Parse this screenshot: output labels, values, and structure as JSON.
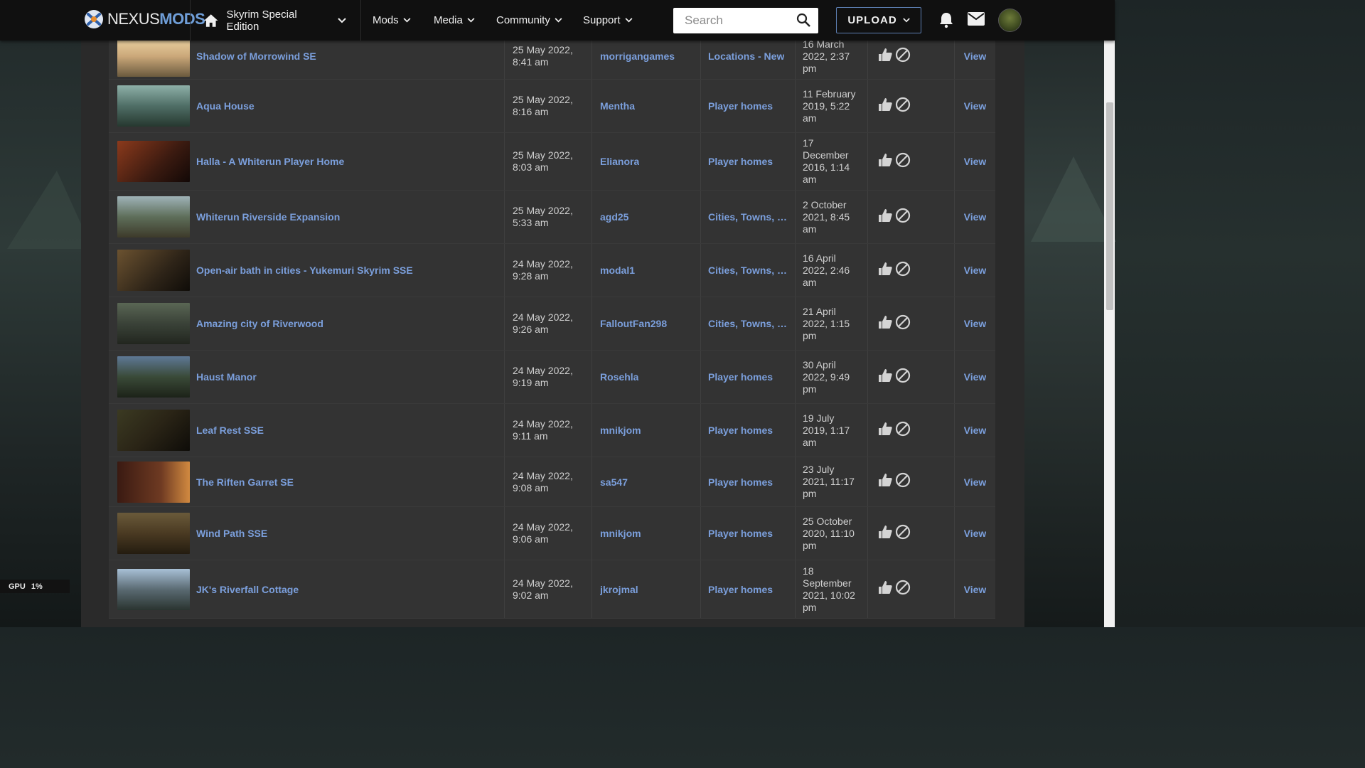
{
  "header": {
    "logo_a": "NEXUS",
    "logo_b": "MODS",
    "game": "Skyrim Special Edition",
    "nav": [
      {
        "label": "Mods"
      },
      {
        "label": "Media"
      },
      {
        "label": "Community"
      },
      {
        "label": "Support"
      }
    ],
    "search_placeholder": "Search",
    "upload_label": "UPLOAD",
    "icons": {
      "home": "home-icon",
      "chevron": "chevron-down-icon",
      "search": "search-icon",
      "bell": "bell-icon",
      "mail": "mail-icon"
    }
  },
  "colors": {
    "link": "#7b9fdc",
    "brand_accent": "#6f9ed8",
    "header_bg": "#101010",
    "row_bg": "#333333"
  },
  "rows": [
    {
      "name": "Shadow of Morrowind SE",
      "date": [
        "25 May 2022,",
        "8:41 am"
      ],
      "author": "morrigangames",
      "category": "Locations - New",
      "updated": [
        "16 March",
        "2022, 2:37",
        "pm"
      ],
      "view": "View"
    },
    {
      "name": "Aqua House",
      "date": [
        "25 May 2022,",
        "8:16 am"
      ],
      "author": "Mentha",
      "category": "Player homes",
      "updated": [
        "11 February",
        "2019, 5:22",
        "am"
      ],
      "view": "View"
    },
    {
      "name": "Halla - A Whiterun Player Home",
      "date": [
        "25 May 2022,",
        "8:03 am"
      ],
      "author": "Elianora",
      "category": "Player homes",
      "updated": [
        "17",
        "December",
        "2016, 1:14",
        "am"
      ],
      "view": "View"
    },
    {
      "name": "Whiterun Riverside Expansion",
      "date": [
        "25 May 2022,",
        "5:33 am"
      ],
      "author": "agd25",
      "category": "Cities, Towns, Vi...",
      "updated": [
        "2 October",
        "2021, 8:45",
        "am"
      ],
      "view": "View"
    },
    {
      "name": "Open-air bath in cities - Yukemuri Skyrim SSE",
      "date": [
        "24 May 2022,",
        "9:28 am"
      ],
      "author": "modal1",
      "category": "Cities, Towns, Vi...",
      "updated": [
        "16 April",
        "2022, 2:46",
        "am"
      ],
      "view": "View"
    },
    {
      "name": "Amazing city of Riverwood",
      "date": [
        "24 May 2022,",
        "9:26 am"
      ],
      "author": "FalloutFan298",
      "category": "Cities, Towns, Vi...",
      "updated": [
        "21 April",
        "2022, 1:15",
        "pm"
      ],
      "view": "View"
    },
    {
      "name": "Haust Manor",
      "date": [
        "24 May 2022,",
        "9:19 am"
      ],
      "author": "Rosehla",
      "category": "Player homes",
      "updated": [
        "30 April",
        "2022, 9:49",
        "pm"
      ],
      "view": "View"
    },
    {
      "name": "Leaf Rest SSE",
      "date": [
        "24 May 2022,",
        "9:11 am"
      ],
      "author": "mnikjom",
      "category": "Player homes",
      "updated": [
        "19 July",
        "2019, 1:17",
        "am"
      ],
      "view": "View"
    },
    {
      "name": "The Riften Garret SE",
      "date": [
        "24 May 2022,",
        "9:08 am"
      ],
      "author": "sa547",
      "category": "Player homes",
      "updated": [
        "23 July",
        "2021, 11:17",
        "pm"
      ],
      "view": "View"
    },
    {
      "name": "Wind Path SSE",
      "date": [
        "24 May 2022,",
        "9:06 am"
      ],
      "author": "mnikjom",
      "category": "Player homes",
      "updated": [
        "25 October",
        "2020, 11:10",
        "pm"
      ],
      "view": "View"
    },
    {
      "name": "JK's Riverfall Cottage",
      "date": [
        "24 May 2022,",
        "9:02 am"
      ],
      "author": "jkrojmal",
      "category": "Player homes",
      "updated": [
        "18",
        "September",
        "2021, 10:02",
        "pm"
      ],
      "view": "View"
    }
  ],
  "gpu_overlay": {
    "label": "GPU",
    "value": "1%"
  }
}
